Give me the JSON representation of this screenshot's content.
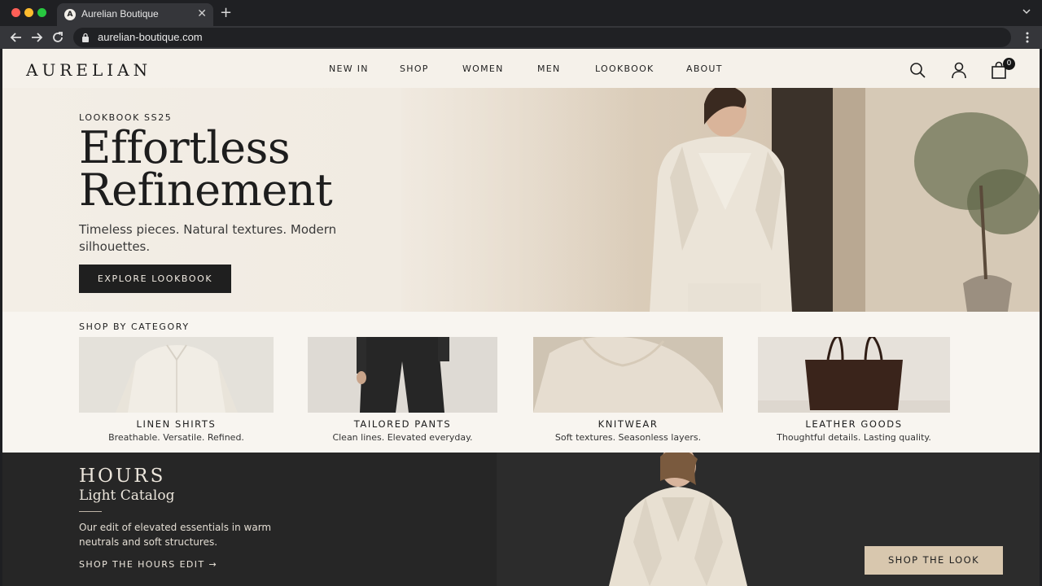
{
  "browser": {
    "tab_title": "Aurelian Boutique",
    "tab_favicon": "A",
    "new_tab_glyph": "+",
    "close_glyph": "✕",
    "url": "aurelian-boutique.com"
  },
  "header": {
    "logo": "AURELIAN",
    "nav": [
      "NEW IN",
      "SHOP",
      "WOMEN",
      "MEN",
      "LOOKBOOK",
      "ABOUT"
    ],
    "icons": [
      "search-icon",
      "account-icon",
      "shopping-bag-icon"
    ],
    "cart_count": "0"
  },
  "hero": {
    "eyebrow": "LOOKBOOK SS25",
    "title_line1": "Effortless",
    "title_line2": "Refinement",
    "subtitle": "Timeless pieces. Natural textures. Modern silhouettes.",
    "cta": "EXPLORE LOOKBOOK"
  },
  "categories": {
    "title": "SHOP BY CATEGORY",
    "items": [
      {
        "name": "LINEN SHIRTS",
        "desc": "Breathable. Versatile. Refined."
      },
      {
        "name": "TAILORED PANTS",
        "desc": "Clean lines. Elevated everyday."
      },
      {
        "name": "KNITWEAR",
        "desc": "Soft textures. Seasonless layers."
      },
      {
        "name": "LEATHER GOODS",
        "desc": "Thoughtful details. Lasting quality."
      }
    ]
  },
  "feature": {
    "title": "HOURS",
    "subtitle": "Light Catalog",
    "text": "Our edit of elevated essentials in warm neutrals and soft structures.",
    "link": "SHOP THE HOURS EDIT →",
    "cta": "SHOP THE LOOK"
  },
  "colors": {
    "page_bg": "#f5f1ea",
    "dark_band": "#262626",
    "primary_button": "#1f1f1f",
    "accent_button": "#d8c7ae"
  }
}
